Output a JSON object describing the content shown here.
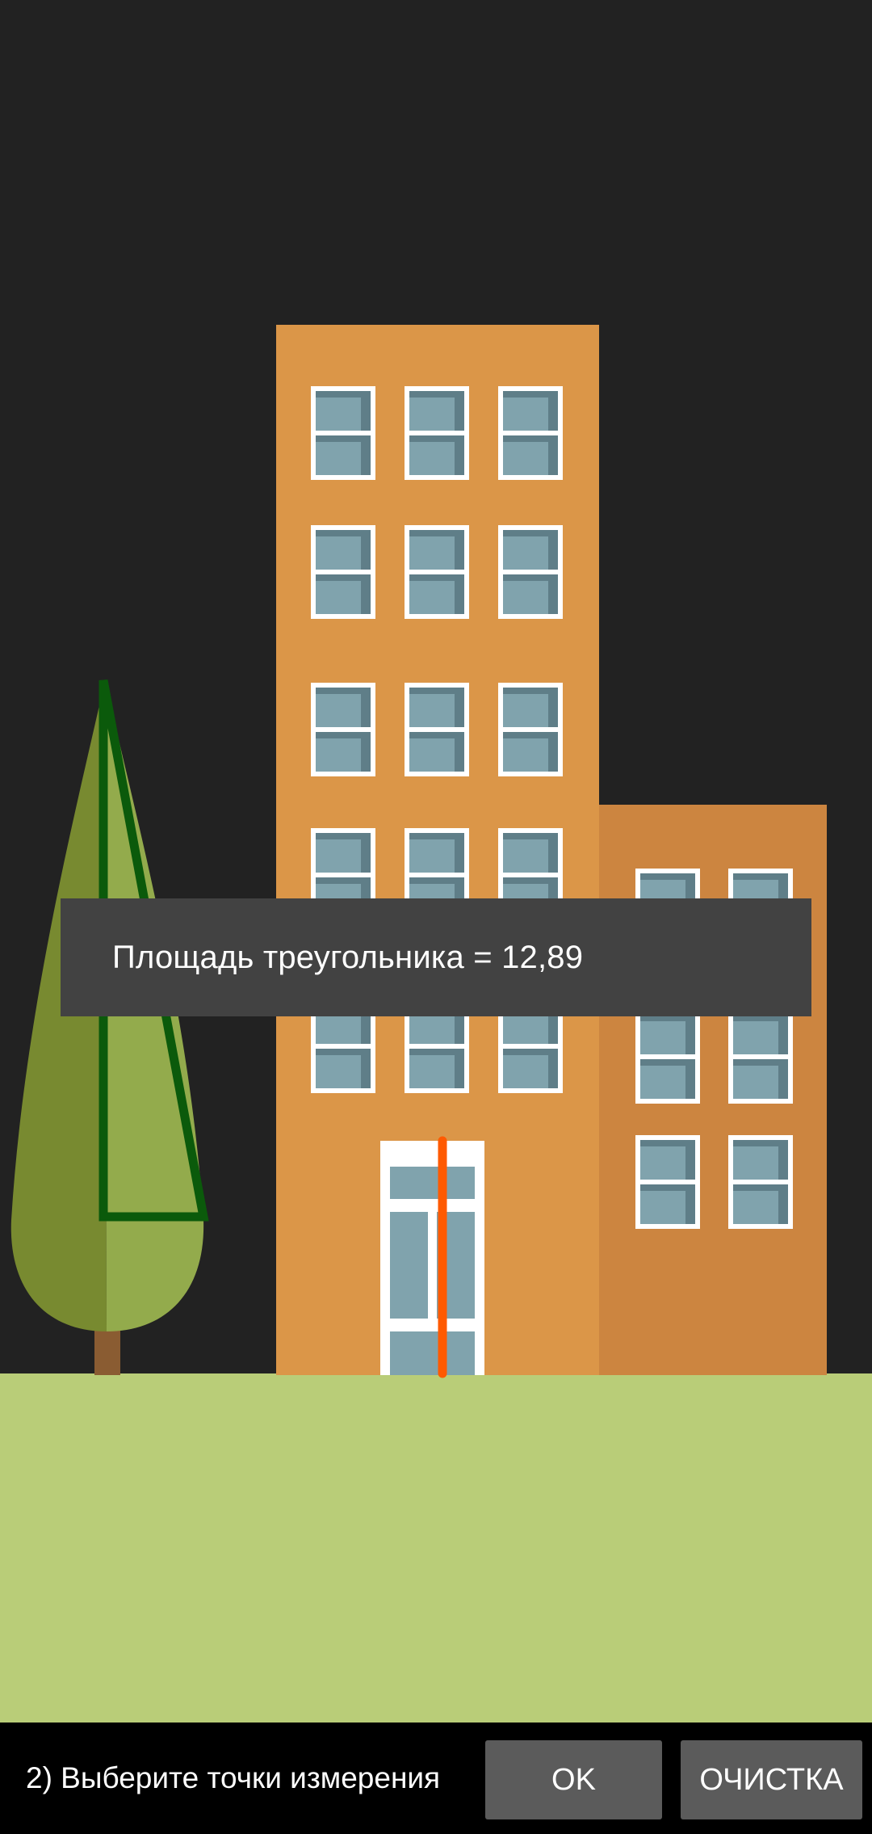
{
  "colors": {
    "background": "#222222",
    "ground": "#b9cd78",
    "building_main": "#db9648",
    "building_annex": "#cc8540",
    "window_frame": "#ffffff",
    "window_glass": "#80a3ad",
    "window_glass_shadow": "#5f7e88",
    "tree_dark": "#788a30",
    "tree_light": "#93ab4c",
    "trunk": "#8a5c32",
    "triangle_measure": "#0b5a0b",
    "height_line": "#ff5a00",
    "toast_bg": "#424242",
    "button_bg": "#5b5b5b",
    "bottom_bar_bg": "#000000"
  },
  "measurement": {
    "result_text": "Площадь треугольника = 12,89"
  },
  "bottom_bar": {
    "instruction": "2) Выберите точки измерения",
    "ok_label": "OK",
    "clear_label": "ОЧИСТКА"
  },
  "icons": {
    "scene": "building-scene-illustration"
  }
}
